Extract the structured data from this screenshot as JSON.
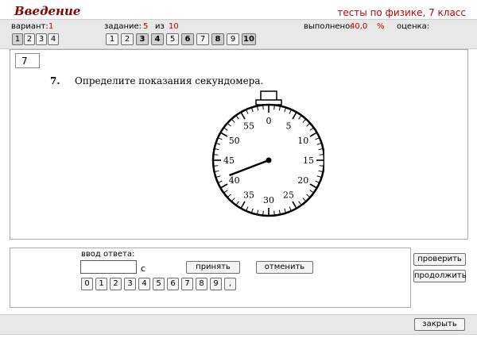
{
  "header": {
    "title": "Введение",
    "subtitle": "тесты по физике, 7 класс"
  },
  "variant": {
    "label": "вариант:",
    "value": "1",
    "options": [
      "1",
      "2",
      "3",
      "4"
    ]
  },
  "task": {
    "label": "задание:",
    "value": "5",
    "of_label": "из",
    "total": "10",
    "numbers": [
      {
        "n": "1",
        "done": false
      },
      {
        "n": "2",
        "done": false
      },
      {
        "n": "3",
        "done": true
      },
      {
        "n": "4",
        "done": true
      },
      {
        "n": "5",
        "done": false
      },
      {
        "n": "6",
        "done": true
      },
      {
        "n": "7",
        "done": false
      },
      {
        "n": "8",
        "done": true
      },
      {
        "n": "9",
        "done": false
      },
      {
        "n": "10",
        "done": true
      }
    ]
  },
  "progress": {
    "label": "выполнено:",
    "value": "40,0",
    "unit": "%",
    "grade_label": "оценка:",
    "grade_value": ""
  },
  "question": {
    "box_number": "7",
    "number": "7.",
    "text": "Определите показания секундомера.",
    "dial_labels": [
      "0",
      "5",
      "10",
      "15",
      "20",
      "25",
      "30",
      "35",
      "40",
      "45",
      "50",
      "55"
    ],
    "hand_reading_seconds": 41.5
  },
  "answer": {
    "input_label": "ввод ответа:",
    "input_value": "",
    "unit": "с",
    "accept_label": "принять",
    "cancel_label": "отменить",
    "keypad": [
      "0",
      "1",
      "2",
      "3",
      "4",
      "5",
      "6",
      "7",
      "8",
      "9",
      ","
    ]
  },
  "side": {
    "check_label": "проверить",
    "continue_label": "продолжить"
  },
  "footer": {
    "close_label": "закрыть"
  },
  "colors": {
    "accent_red": "#c00000",
    "bar_gray": "#e8e8e8"
  }
}
